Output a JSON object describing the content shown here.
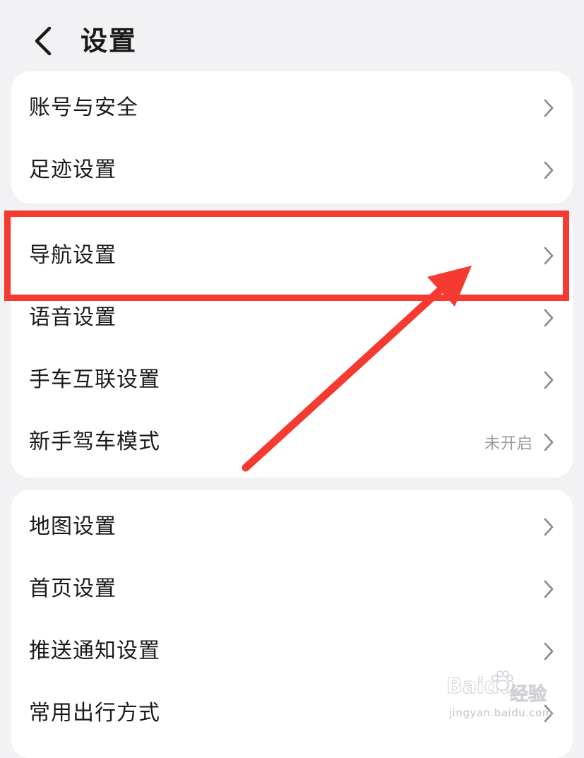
{
  "header": {
    "title": "设置",
    "back_icon": "chevron-left-icon"
  },
  "groups": [
    {
      "items": [
        {
          "label": "账号与安全",
          "status": ""
        },
        {
          "label": "足迹设置",
          "status": ""
        }
      ]
    },
    {
      "items": [
        {
          "label": "导航设置",
          "status": ""
        },
        {
          "label": "语音设置",
          "status": ""
        },
        {
          "label": "手车互联设置",
          "status": ""
        },
        {
          "label": "新手驾车模式",
          "status": "未开启"
        }
      ]
    },
    {
      "items": [
        {
          "label": "地图设置",
          "status": ""
        },
        {
          "label": "首页设置",
          "status": ""
        },
        {
          "label": "推送通知设置",
          "status": ""
        },
        {
          "label": "常用出行方式",
          "status": ""
        }
      ]
    }
  ],
  "annotation": {
    "highlight_target": "导航设置",
    "color": "#f53a32"
  },
  "watermark": {
    "logo": "Baidu",
    "cn": "经验",
    "url": "jingyan.baidu.com"
  },
  "colors": {
    "background": "#f2f2f5",
    "card": "#ffffff",
    "text": "#1a1a1a",
    "status": "#9a9a9a",
    "chevron": "#8a8a8a"
  }
}
